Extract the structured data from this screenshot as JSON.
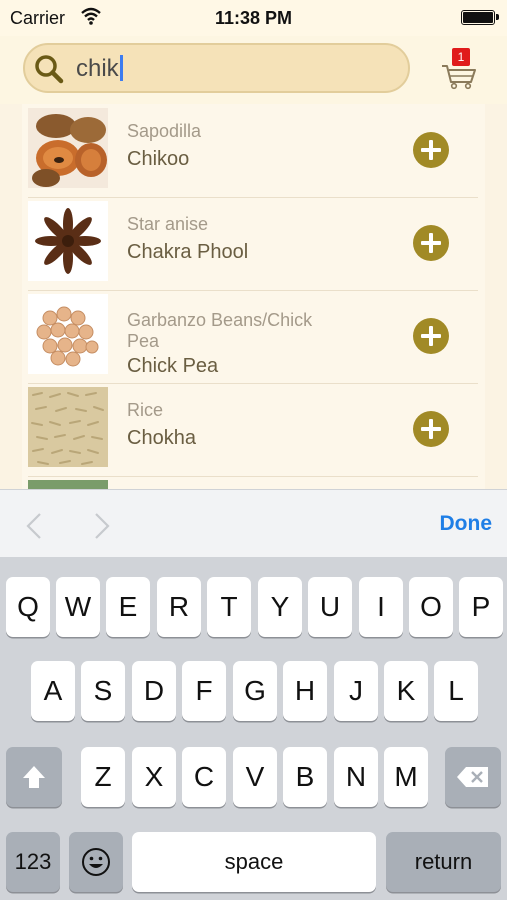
{
  "status_bar": {
    "carrier": "Carrier",
    "time": "11:38 PM"
  },
  "search": {
    "query": "chik"
  },
  "cart": {
    "badge_count": "1"
  },
  "items": [
    {
      "english": "Sapodilla",
      "hindi": "Chikoo"
    },
    {
      "english": "Star anise",
      "hindi": "Chakra Phool"
    },
    {
      "english": "Garbanzo Beans/Chick Pea",
      "hindi": "Chick Pea"
    },
    {
      "english": "Rice",
      "hindi": "Chokha"
    }
  ],
  "accessory": {
    "done_label": "Done"
  },
  "keyboard": {
    "row1": [
      "Q",
      "W",
      "E",
      "R",
      "T",
      "Y",
      "U",
      "I",
      "O",
      "P"
    ],
    "row2": [
      "A",
      "S",
      "D",
      "F",
      "G",
      "H",
      "J",
      "K",
      "L"
    ],
    "row3": [
      "Z",
      "X",
      "C",
      "V",
      "B",
      "N",
      "M"
    ],
    "numbers_label": "123",
    "space_label": "space",
    "return_label": "return"
  },
  "colors": {
    "accent_add": "#a18a26",
    "done_blue": "#1f7ee6",
    "badge_red": "#e01b1b"
  }
}
